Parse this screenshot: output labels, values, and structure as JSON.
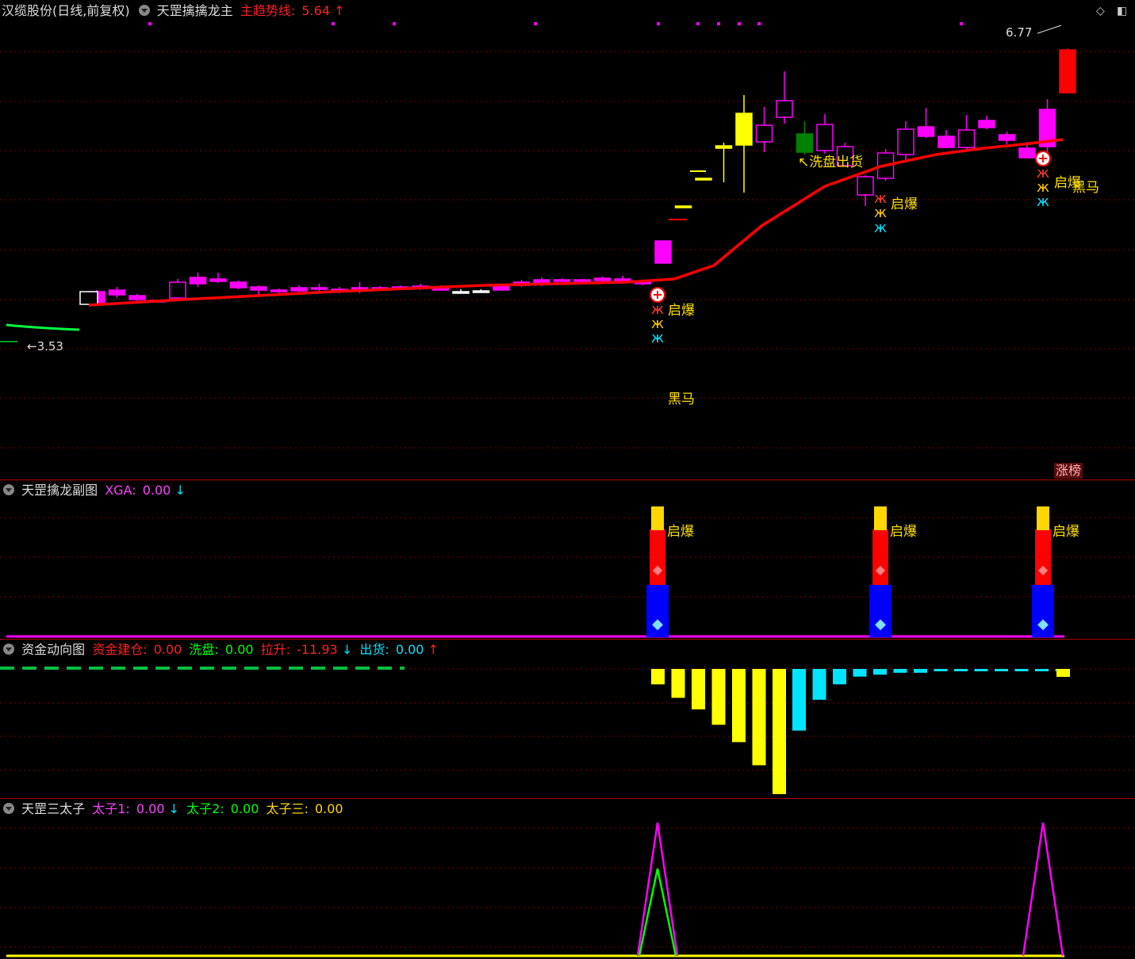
{
  "panels": {
    "main": {
      "title": "汉缆股份(日线,前复权)",
      "indicator": "天罡擒擒龙主",
      "label": "主趋势线",
      "value": "5.64",
      "arrow": "↑",
      "high_label": "6.77",
      "low_label": "3.53",
      "annotations": {
        "qibao": "启爆",
        "heima": "黑马",
        "xipan": "↖洗盘出货"
      },
      "badge": "涨榜"
    },
    "sub1": {
      "title": "天罡擒龙副图",
      "label": "XGA",
      "value": "0.00",
      "arrow": "↓",
      "qibao": "启爆"
    },
    "sub2": {
      "title": "资金动向图",
      "l1": "资金建仓",
      "v1": "0.00",
      "l2": "洗盘",
      "v2": "0.00",
      "l3": "拉升",
      "v3": "-11.93",
      "a3": "↓",
      "l4": "出货",
      "v4": "0.00",
      "a4": "↑"
    },
    "sub3": {
      "title": "天罡三太子",
      "l1": "太子1",
      "v1": "0.00",
      "a1": "↓",
      "l2": "太子2",
      "v2": "0.00",
      "l3": "太子三",
      "v3": "0.00"
    }
  },
  "colors": {
    "up": "#ff00ff",
    "down": "#008000",
    "trend": "#ff0000",
    "flat": "#ffff00",
    "cyan": "#00e5ff",
    "yellow": "#ffff00",
    "green": "#00ff00",
    "magenta": "#ff00ff",
    "grid": "#7a0000"
  },
  "icons": [
    "settings-toggle-icon",
    "diamond-icon",
    "window-icon",
    "butterfly-icon",
    "gem-icon",
    "plus-circle-icon"
  ],
  "chart_data": [
    {
      "type": "candlestick",
      "title": "",
      "ylim": [
        3.3,
        7.0
      ],
      "candles": [
        {
          "i": 0,
          "o": 3.58,
          "c": 3.72,
          "h": 3.74,
          "l": 3.56,
          "d": "up"
        },
        {
          "i": 1,
          "o": 3.68,
          "c": 3.74,
          "h": 3.78,
          "l": 3.64,
          "d": "up"
        },
        {
          "i": 2,
          "o": 3.62,
          "c": 3.67,
          "h": 3.69,
          "l": 3.6,
          "d": "up"
        },
        {
          "i": 3,
          "o": 3.61,
          "c": 3.61,
          "h": 3.62,
          "l": 3.59,
          "d": "up"
        },
        {
          "i": 4,
          "o": 3.64,
          "c": 3.84,
          "h": 3.88,
          "l": 3.62,
          "d": "up"
        },
        {
          "i": 5,
          "o": 3.82,
          "c": 3.9,
          "h": 3.96,
          "l": 3.78,
          "d": "up"
        },
        {
          "i": 6,
          "o": 3.85,
          "c": 3.88,
          "h": 3.96,
          "l": 3.83,
          "d": "up"
        },
        {
          "i": 7,
          "o": 3.77,
          "c": 3.84,
          "h": 3.86,
          "l": 3.75,
          "d": "up"
        },
        {
          "i": 8,
          "o": 3.74,
          "c": 3.78,
          "h": 3.8,
          "l": 3.66,
          "d": "up"
        },
        {
          "i": 9,
          "o": 3.72,
          "c": 3.74,
          "h": 3.76,
          "l": 3.69,
          "d": "up"
        },
        {
          "i": 10,
          "o": 3.73,
          "c": 3.77,
          "h": 3.8,
          "l": 3.71,
          "d": "up"
        },
        {
          "i": 11,
          "o": 3.75,
          "c": 3.77,
          "h": 3.82,
          "l": 3.73,
          "d": "up"
        },
        {
          "i": 12,
          "o": 3.72,
          "c": 3.75,
          "h": 3.78,
          "l": 3.7,
          "d": "up"
        },
        {
          "i": 13,
          "o": 3.73,
          "c": 3.77,
          "h": 3.84,
          "l": 3.7,
          "d": "up"
        },
        {
          "i": 14,
          "o": 3.75,
          "c": 3.77,
          "h": 3.79,
          "l": 3.73,
          "d": "up"
        },
        {
          "i": 15,
          "o": 3.76,
          "c": 3.78,
          "h": 3.8,
          "l": 3.74,
          "d": "up"
        },
        {
          "i": 16,
          "o": 3.76,
          "c": 3.79,
          "h": 3.82,
          "l": 3.74,
          "d": "up"
        },
        {
          "i": 17,
          "o": 3.75,
          "c": 3.76,
          "h": 3.8,
          "l": 3.74,
          "d": "up"
        },
        {
          "i": 18,
          "o": 3.72,
          "c": 3.72,
          "h": 3.75,
          "l": 3.7,
          "d": "doji"
        },
        {
          "i": 19,
          "o": 3.73,
          "c": 3.73,
          "h": 3.75,
          "l": 3.72,
          "d": "doji"
        },
        {
          "i": 20,
          "o": 3.74,
          "c": 3.8,
          "h": 3.82,
          "l": 3.73,
          "d": "up"
        },
        {
          "i": 21,
          "o": 3.8,
          "c": 3.84,
          "h": 3.87,
          "l": 3.78,
          "d": "up"
        },
        {
          "i": 22,
          "o": 3.81,
          "c": 3.87,
          "h": 3.9,
          "l": 3.79,
          "d": "up"
        },
        {
          "i": 23,
          "o": 3.85,
          "c": 3.87,
          "h": 3.89,
          "l": 3.84,
          "d": "up"
        },
        {
          "i": 24,
          "o": 3.86,
          "c": 3.87,
          "h": 3.88,
          "l": 3.85,
          "d": "up"
        },
        {
          "i": 25,
          "o": 3.86,
          "c": 3.89,
          "h": 3.91,
          "l": 3.84,
          "d": "up"
        },
        {
          "i": 26,
          "o": 3.84,
          "c": 3.88,
          "h": 3.92,
          "l": 3.82,
          "d": "up"
        },
        {
          "i": 27,
          "o": 3.82,
          "c": 3.84,
          "h": 3.86,
          "l": 3.8,
          "d": "up"
        },
        {
          "i": 28,
          "o": 4.08,
          "c": 4.36,
          "h": 4.36,
          "l": 4.08,
          "d": "up"
        },
        {
          "i": 29,
          "o": 4.8,
          "c": 4.8,
          "h": 4.8,
          "l": 4.8,
          "d": "flat"
        },
        {
          "i": 30,
          "o": 5.15,
          "c": 5.15,
          "h": 5.15,
          "l": 5.15,
          "d": "flat"
        },
        {
          "i": 31,
          "o": 5.53,
          "c": 5.56,
          "h": 5.6,
          "l": 5.1,
          "d": "flat"
        },
        {
          "i": 32,
          "o": 5.57,
          "c": 5.97,
          "h": 6.2,
          "l": 4.97,
          "d": "flat"
        },
        {
          "i": 33,
          "o": 5.61,
          "c": 5.82,
          "h": 6.05,
          "l": 5.48,
          "d": "up"
        },
        {
          "i": 34,
          "o": 5.92,
          "c": 6.13,
          "h": 6.5,
          "l": 5.84,
          "d": "up"
        },
        {
          "i": 35,
          "o": 5.71,
          "c": 5.48,
          "h": 5.87,
          "l": 5.45,
          "d": "down"
        },
        {
          "i": 36,
          "o": 5.5,
          "c": 5.83,
          "h": 5.96,
          "l": 5.46,
          "d": "up"
        },
        {
          "i": 37,
          "o": 5.31,
          "c": 5.55,
          "h": 5.6,
          "l": 5.31,
          "d": "up"
        },
        {
          "i": 38,
          "o": 4.94,
          "c": 5.17,
          "h": 5.19,
          "l": 4.8,
          "d": "up"
        },
        {
          "i": 39,
          "o": 5.15,
          "c": 5.47,
          "h": 5.52,
          "l": 5.12,
          "d": "up"
        },
        {
          "i": 40,
          "o": 5.45,
          "c": 5.77,
          "h": 5.87,
          "l": 5.39,
          "d": "up"
        },
        {
          "i": 41,
          "o": 5.68,
          "c": 5.8,
          "h": 6.04,
          "l": 5.66,
          "d": "up"
        },
        {
          "i": 42,
          "o": 5.54,
          "c": 5.68,
          "h": 5.76,
          "l": 5.53,
          "d": "up"
        },
        {
          "i": 43,
          "o": 5.54,
          "c": 5.76,
          "h": 5.95,
          "l": 5.5,
          "d": "up"
        },
        {
          "i": 44,
          "o": 5.79,
          "c": 5.88,
          "h": 5.94,
          "l": 5.77,
          "d": "up"
        },
        {
          "i": 45,
          "o": 5.63,
          "c": 5.7,
          "h": 5.74,
          "l": 5.58,
          "d": "up"
        },
        {
          "i": 46,
          "o": 5.41,
          "c": 5.53,
          "h": 5.61,
          "l": 5.41,
          "d": "up"
        },
        {
          "i": 47,
          "o": 5.55,
          "c": 6.02,
          "h": 6.15,
          "l": 5.41,
          "d": "up"
        },
        {
          "i": 48,
          "o": 6.23,
          "c": 6.77,
          "h": 6.79,
          "l": 6.23,
          "d": "trend"
        }
      ],
      "trend_line": [
        3.55,
        3.62,
        3.72,
        3.8,
        3.84,
        3.88,
        4.05,
        4.55,
        5.05,
        5.3,
        5.45,
        5.53,
        5.58,
        5.64
      ]
    },
    {
      "type": "bar",
      "series": [
        {
          "name": "资金建仓",
          "color": "yellow",
          "values": [
            0.8,
            1.5,
            2.1,
            2.9,
            3.8,
            5.0,
            6.5
          ]
        },
        {
          "name": "洗盘",
          "color": "cyan",
          "values": [
            3.2,
            1.6,
            0.8,
            0.4,
            0.3,
            0.2,
            0.2,
            0.1,
            0.1,
            0.1,
            0.1,
            0.1,
            0.1,
            0.1
          ]
        }
      ],
      "ylim": [
        -7,
        0.5
      ]
    },
    {
      "type": "line",
      "series": [
        {
          "name": "太子1",
          "peaks": [
            {
              "i": 28,
              "v": 1.0
            },
            {
              "i": 47,
              "v": 1.0
            }
          ]
        },
        {
          "name": "太子2",
          "peaks": [
            {
              "i": 28,
              "v": 0.66
            }
          ]
        }
      ],
      "ylim": [
        0,
        1.1
      ]
    }
  ]
}
